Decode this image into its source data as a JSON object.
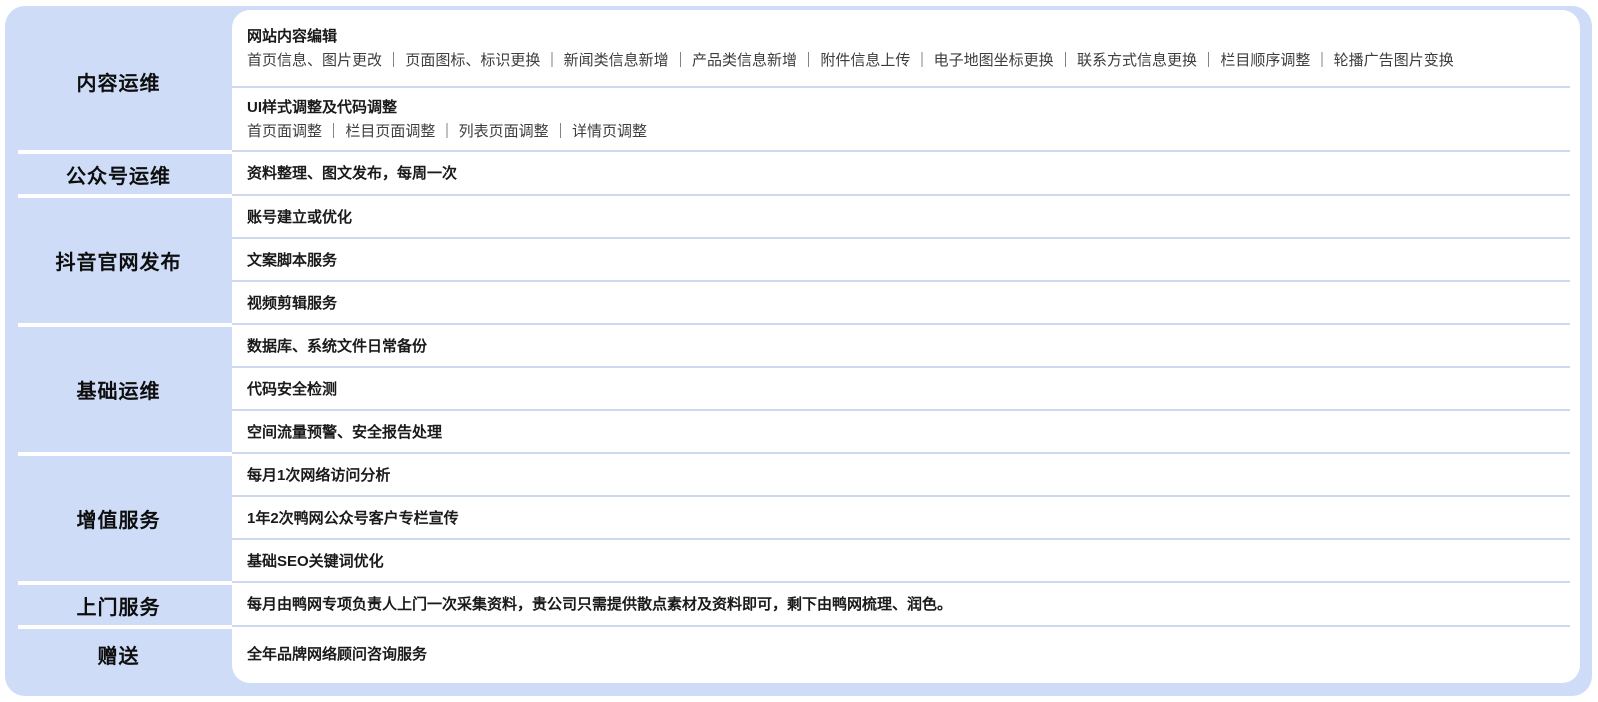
{
  "theme": {
    "card_bg": "#cedcf7",
    "panel_bg": "#ffffff",
    "panel_divider": "#cdd9f0",
    "category_divider": "#ffffff",
    "title_color": "#1a1a1a",
    "detail_color": "#3d3d3d"
  },
  "groups": [
    {
      "label": "内容运维",
      "rows": [
        {
          "title": "网站内容编辑",
          "detail": "首页信息、图片更改 ｜ 页面图标、标识更换 ｜ 新闻类信息新增 ｜ 产品类信息新增 ｜ 附件信息上传 ｜ 电子地图坐标更换 ｜ 联系方式信息更换 ｜ 栏目顺序调整 ｜ 轮播广告图片变换"
        },
        {
          "title": "UI样式调整及代码调整",
          "detail": "首页面调整 ｜ 栏目页面调整 ｜ 列表页面调整 ｜ 详情页调整"
        }
      ]
    },
    {
      "label": "公众号运维",
      "rows": [
        {
          "title": "资料整理、图文发布，每周一次"
        }
      ]
    },
    {
      "label": "抖音官网发布",
      "rows": [
        {
          "title": "账号建立或优化"
        },
        {
          "title": "文案脚本服务"
        },
        {
          "title": "视频剪辑服务"
        }
      ]
    },
    {
      "label": "基础运维",
      "rows": [
        {
          "title": "数据库、系统文件日常备份"
        },
        {
          "title": "代码安全检测"
        },
        {
          "title": "空间流量预警、安全报告处理"
        }
      ]
    },
    {
      "label": "增值服务",
      "rows": [
        {
          "title": "每月1次网络访问分析"
        },
        {
          "title": "1年2次鸭网公众号客户专栏宣传"
        },
        {
          "title": "基础SEO关键词优化"
        }
      ]
    },
    {
      "label": "上门服务",
      "rows": [
        {
          "title": "每月由鸭网专项负责人上门一次采集资料，贵公司只需提供散点素材及资料即可，剩下由鸭网梳理、润色。"
        }
      ]
    },
    {
      "label": "赠送",
      "rows": [
        {
          "title": "全年品牌网络顾问咨询服务"
        }
      ]
    }
  ]
}
